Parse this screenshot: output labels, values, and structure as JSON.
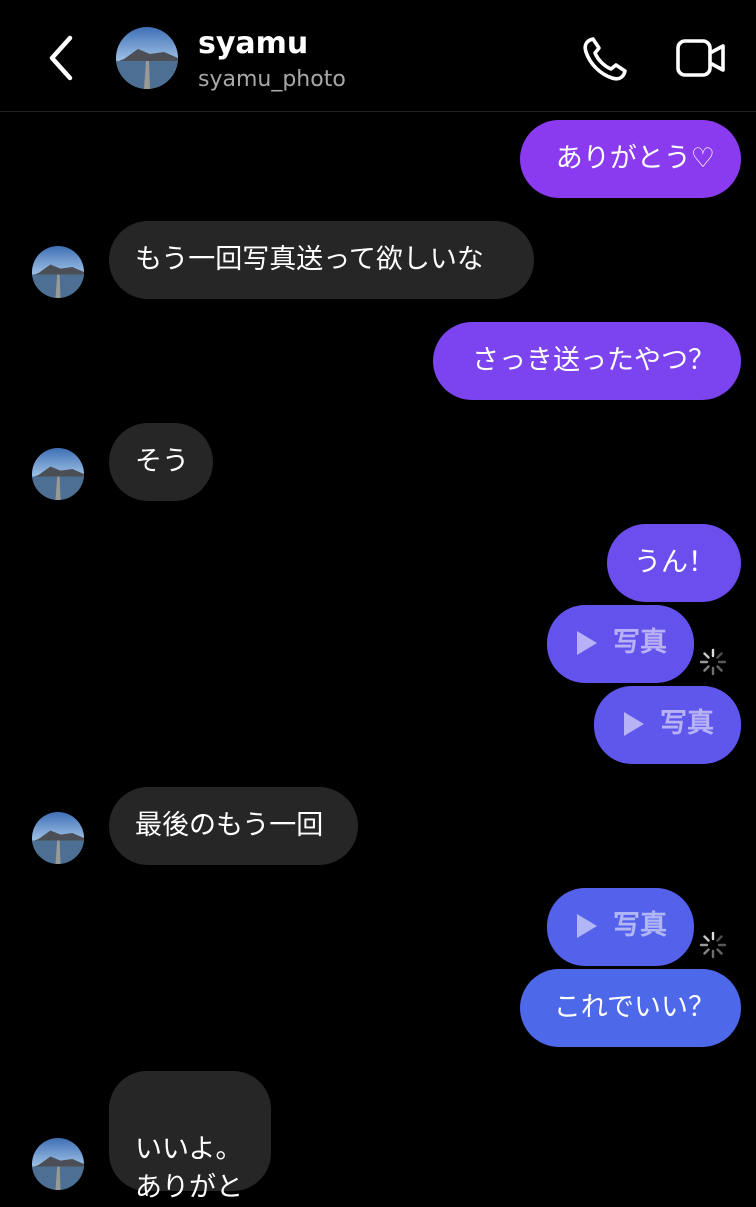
{
  "header": {
    "username": "syamu",
    "handle": "syamu_photo"
  },
  "messages": {
    "m1": "ありがとう♡",
    "m2": "もう一回写真送って欲しいな",
    "m3": "さっき送ったやつ？",
    "m4": "そう",
    "m5": "うん！",
    "m6": "写真",
    "m7": "写真",
    "m8": "最後のもう一回",
    "m9": "写真",
    "m10": "これでいい？",
    "m11": "いいよ。\nありがと"
  },
  "colors": {
    "background": "#000000",
    "incoming_bubble": "#262626",
    "outgoing_gradient_top": "#8a3cf0",
    "outgoing_gradient_bottom": "#4c6be8",
    "secondary_text": "#a8a8a8"
  },
  "icons": {
    "back": "chevron-left-icon",
    "call": "phone-icon",
    "video": "video-camera-icon",
    "play": "play-icon",
    "sending": "loading-spinner-icon"
  }
}
